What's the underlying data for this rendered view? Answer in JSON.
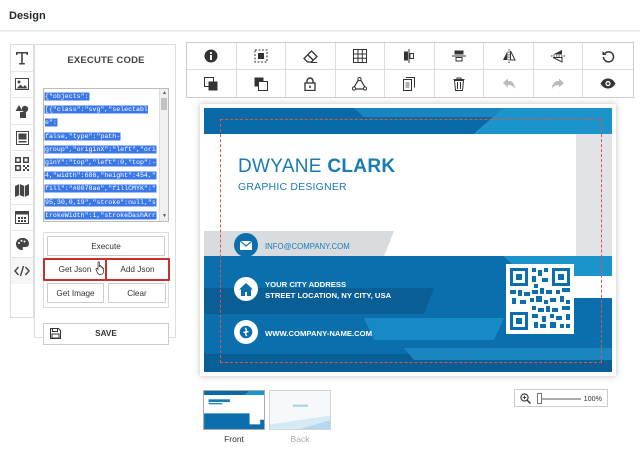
{
  "header": {
    "title": "Design"
  },
  "tools": [
    "text-tool",
    "image-tool",
    "shapes-tool",
    "clipart-tool",
    "qrcode-tool",
    "map-tool",
    "calendar-tool",
    "color-tool",
    "code-tool"
  ],
  "panel": {
    "title": "EXECUTE CODE",
    "code_lines": [
      "{\"objects\":",
      "[{\"class\":\"svg\",\"selectable\":",
      "false,\"type\":\"path-",
      "group\",\"originX\":\"left\",\"ori",
      "ginY\":\"top\",\"left\":0,\"top\":-",
      "4,\"width\":686,\"height\":454,\"",
      "fill\":\"#0078ae\",\"fillCMYK\":\"",
      "95,30,0,19\",\"stroke\":null,\"s",
      "trokeWidth\":1,\"strokeDashArr",
      "ay\":null,\"strokeLineCap\":\"bu",
      "tt\",\"strokeLineJoin\":\"miter\""
    ],
    "buttons": {
      "execute": "Execute",
      "get_json": "Get Json",
      "add_json": "Add Json",
      "get_image": "Get Image",
      "clear": "Clear",
      "save": "SAVE"
    }
  },
  "toolbar": {
    "row1": [
      "info-icon",
      "select-all-icon",
      "eraser-icon",
      "grid-icon",
      "align-center-icon",
      "align-middle-icon",
      "flip-horizontal-icon",
      "flip-vertical-icon",
      "reset-icon"
    ],
    "row2": [
      "bring-forward-icon",
      "send-backward-icon",
      "lock-icon",
      "group-icon",
      "copy-icon",
      "delete-icon",
      "undo-icon",
      "redo-icon",
      "preview-icon"
    ]
  },
  "card": {
    "first_name": "DWYANE ",
    "last_name": "CLARK",
    "role": "GRAPHIC DESIGNER",
    "email": "INFO@COMPANY.COM",
    "address1": "YOUR CITY ADDRESS",
    "address2": "STREET LOCATION, NY CITY, USA",
    "website": "WWW.COMPANY-NAME.COM",
    "brand_color": "#0078ae"
  },
  "thumbs": {
    "front": "Front",
    "back": "Back"
  },
  "zoom": {
    "value": "100%",
    "level": 0.0
  }
}
